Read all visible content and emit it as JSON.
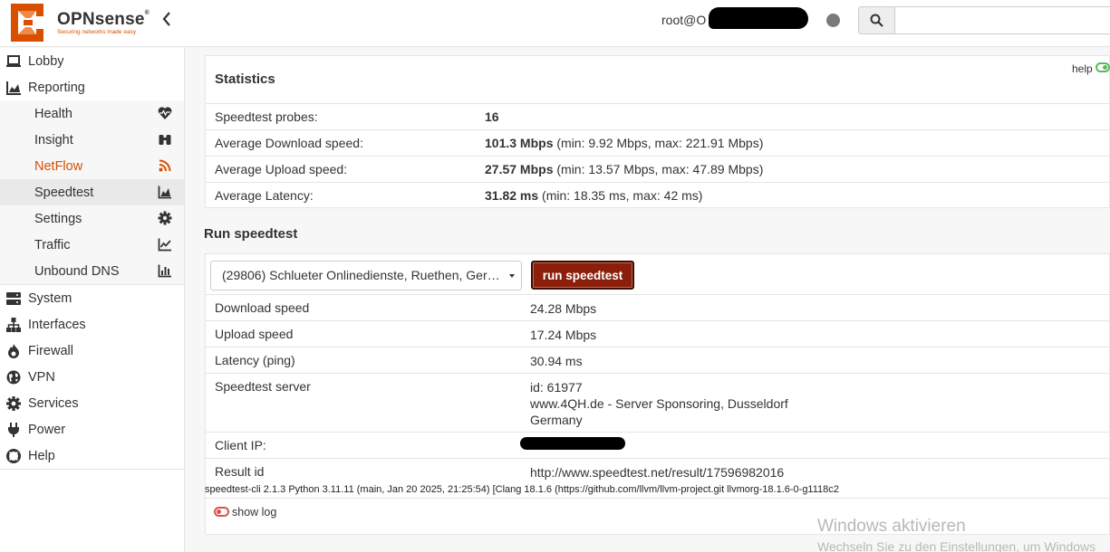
{
  "header": {
    "brand": "OPNsense",
    "brand_mark": "®",
    "tagline": "Securing networks made easy",
    "user": "root@O",
    "search_placeholder": ""
  },
  "sidebar": {
    "items": [
      {
        "label": "Lobby",
        "icon": "laptop-icon"
      },
      {
        "label": "Reporting",
        "icon": "area-chart-icon"
      },
      {
        "label": "Health",
        "icon": "heartbeat-icon"
      },
      {
        "label": "Insight",
        "icon": "binoculars-icon"
      },
      {
        "label": "NetFlow",
        "icon": "rss-icon"
      },
      {
        "label": "Speedtest",
        "icon": "area-chart-icon"
      },
      {
        "label": "Settings",
        "icon": "gear-icon"
      },
      {
        "label": "Traffic",
        "icon": "line-chart-icon"
      },
      {
        "label": "Unbound DNS",
        "icon": "bar-chart-icon"
      },
      {
        "label": "System",
        "icon": "server-icon"
      },
      {
        "label": "Interfaces",
        "icon": "sitemap-icon"
      },
      {
        "label": "Firewall",
        "icon": "fire-icon"
      },
      {
        "label": "VPN",
        "icon": "globe-icon"
      },
      {
        "label": "Services",
        "icon": "cogs-icon"
      },
      {
        "label": "Power",
        "icon": "plug-icon"
      },
      {
        "label": "Help",
        "icon": "life-ring-icon"
      }
    ]
  },
  "stats": {
    "title": "Statistics",
    "help": "help",
    "rows": [
      {
        "key": "Speedtest probes:",
        "value": "16",
        "detail": ""
      },
      {
        "key": "Average Download speed:",
        "value": "101.3 Mbps",
        "detail": " (min: 9.92 Mbps, max: 221.91 Mbps)"
      },
      {
        "key": "Average Upload speed:",
        "value": "27.57 Mbps",
        "detail": " (min: 13.57 Mbps, max: 47.89 Mbps)"
      },
      {
        "key": "Average Latency:",
        "value": "31.82 ms",
        "detail": " (min: 18.35 ms, max: 42 ms)"
      }
    ]
  },
  "run": {
    "title": "Run speedtest",
    "server_select": "(29806) Schlueter Onlinedienste, Ruethen, Ger…",
    "button": "run speedtest",
    "rows": [
      {
        "key": "Download speed",
        "value": "24.28 Mbps"
      },
      {
        "key": "Upload speed",
        "value": "17.24 Mbps"
      },
      {
        "key": "Latency (ping)",
        "value": "30.94 ms"
      },
      {
        "key": "Speedtest server",
        "lines": [
          "id: 61977",
          "www.4QH.de - Server Sponsoring, Dusseldorf",
          "Germany"
        ]
      },
      {
        "key": "Client IP:",
        "value": ""
      },
      {
        "key": "Result id",
        "value": "http://www.speedtest.net/result/17596982016"
      }
    ],
    "cli": "speedtest-cli 2.1.3 Python 3.11.11 (main, Jan 20 2025, 21:25:54) [Clang 18.1.6 (https://github.com/llvm/llvm-project.git llvmorg-18.1.6-0-g1118c2",
    "show_log": "show log"
  },
  "watermark": {
    "line1": "Windows aktivieren",
    "line2": "Wechseln Sie zu den Einstellungen, um Windows"
  },
  "colors": {
    "accent": "#d94f00",
    "button": "#8b1f0b",
    "link": "#b3441c",
    "toggle_on": "#5cb85c",
    "toggle_off": "#d9534f"
  }
}
